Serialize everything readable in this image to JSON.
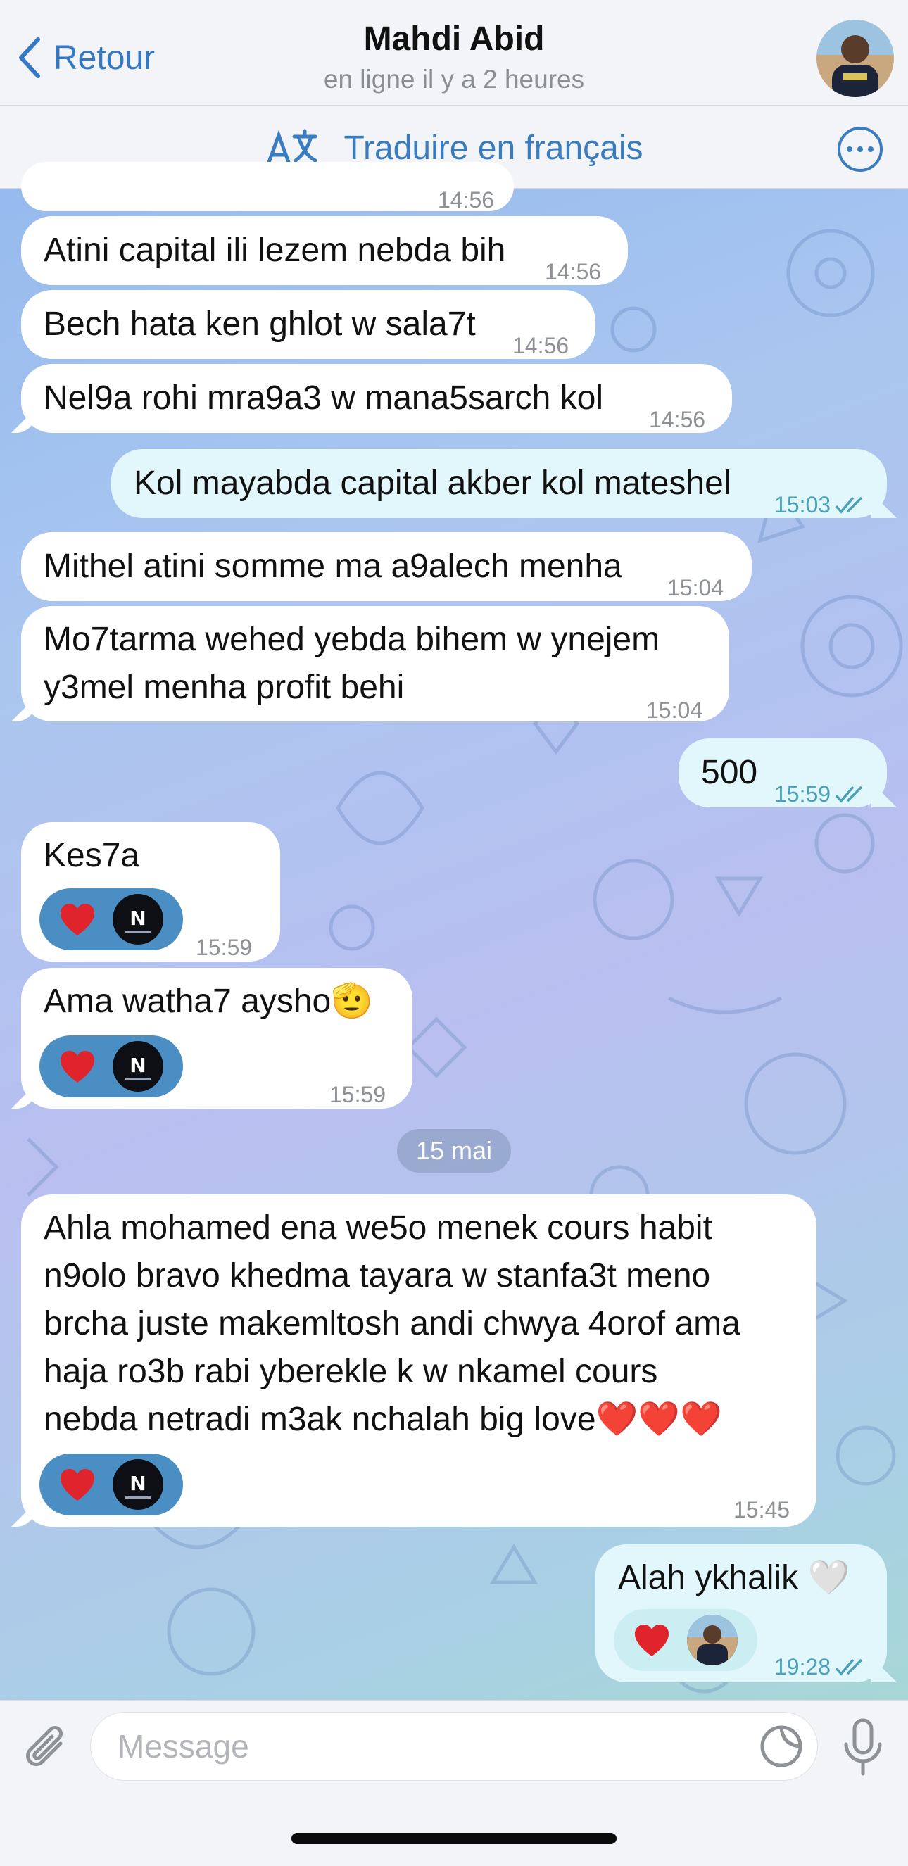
{
  "header": {
    "back_label": "Retour",
    "contact_name": "Mahdi Abid",
    "status": "en ligne il y a 2 heures"
  },
  "translate_bar": {
    "label": "Traduire en français"
  },
  "messages": [
    {
      "direction": "in",
      "text": "Atini capital ili lezem nebda bih",
      "time": "14:56"
    },
    {
      "direction": "in",
      "text": "Bech hata ken ghlot w sala7t",
      "time": "14:56"
    },
    {
      "direction": "in",
      "text": "Nel9a rohi mra9a3 w mana5sarch kol",
      "time": "14:56"
    },
    {
      "direction": "out",
      "text": "Kol mayabda capital akber kol mateshel",
      "time": "15:03"
    },
    {
      "direction": "in",
      "text": "Mithel atini somme ma a9alech menha",
      "time": "15:04"
    },
    {
      "direction": "in",
      "lines": [
        "Mo7tarma wehed yebda bihem w ynejem",
        "y3mel menha profit behi"
      ],
      "time": "15:04"
    },
    {
      "direction": "out",
      "text": "500",
      "time": "15:59"
    },
    {
      "direction": "in",
      "text": "Kes7a",
      "time": "15:59",
      "reaction": "heart"
    },
    {
      "direction": "in",
      "text": "Ama watha7 aysho🫡",
      "time": "15:59",
      "reaction": "heart"
    },
    {
      "direction": "in",
      "lines": [
        "Ahla mohamed ena we5o menek cours habit",
        "n9olo bravo khedma tayara w stanfa3t meno",
        "brcha juste makemltosh andi chwya 4orof ama",
        "haja ro3b rabi yberekle k w nkamel cours",
        "nebda netradi m3ak nchalah big love❤️❤️❤️"
      ],
      "time": "15:45",
      "reaction": "heart"
    },
    {
      "direction": "out",
      "text": "Alah ykhalik 🤍",
      "time": "19:28",
      "reaction": "heart"
    }
  ],
  "date_separator": "15 mai",
  "partial_top_time": "14:56",
  "composer": {
    "placeholder": "Message"
  },
  "colors": {
    "accent": "#3478c6",
    "incoming_bubble": "#ffffff",
    "outgoing_bubble": "#e2f7fb",
    "reaction_bg": "#4a8ec4",
    "heart": "#e0242c"
  },
  "icons": [
    "chevron-left-icon",
    "translate-icon",
    "more-icon",
    "heart-icon",
    "read-checks-icon",
    "paperclip-icon",
    "sticker-icon",
    "microphone-icon"
  ]
}
